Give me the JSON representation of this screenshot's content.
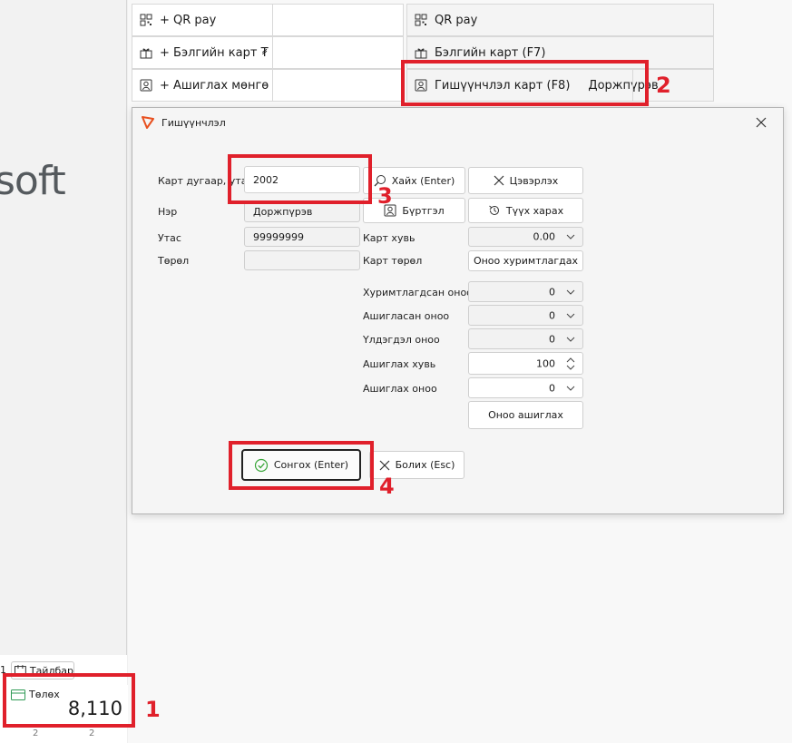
{
  "background": {
    "logo_text": "soft",
    "left_grid": [
      {
        "icon": "qr-icon",
        "label": "+ QR pay"
      },
      {
        "icon": "gift-card-icon",
        "label": "+ Бэлгийн карт ₮"
      },
      {
        "icon": "member-card-icon",
        "label": "+ Ашиглах мөнгө"
      }
    ],
    "right_grid": [
      {
        "icon": "qr-icon",
        "label": "QR pay",
        "value": ""
      },
      {
        "icon": "gift-card-icon",
        "label": "Бэлгийн карт (F7)",
        "value": ""
      },
      {
        "icon": "member-card-icon",
        "label": "Гишүүнчлэл карт (F8)",
        "value": "Доржпүрэв"
      }
    ],
    "note_prefix": "1",
    "note_button": "Тайлбар",
    "payment_label": "Төлөх",
    "payment_amount": "8,110",
    "footer_left": "2",
    "footer_right": "2"
  },
  "dialog": {
    "title": "Гишүүнчлэл",
    "labels": {
      "card_number": "Карт дугаар, утас",
      "name": "Нэр",
      "phone": "Утас",
      "type": "Төрөл",
      "card_rate": "Карт хувь",
      "card_type": "Карт төрөл",
      "accumulated": "Хуримтлагдсан оноо",
      "used": "Ашигласан оноо",
      "remaining": "Үлдэгдэл оноо",
      "use_rate": "Ашиглах хувь",
      "use_points": "Ашиглах оноо"
    },
    "values": {
      "card_number": "2002",
      "name": "Доржпүрэв",
      "phone": "99999999",
      "type": "",
      "card_rate": "0.00",
      "card_type": "Оноо хуримтлагдах",
      "accumulated": "0",
      "used": "0",
      "remaining": "0",
      "use_rate": "100",
      "use_points": "0"
    },
    "buttons": {
      "search": "Хайх (Enter)",
      "clear": "Цэвэрлэх",
      "register": "Бүртгэл",
      "history": "Түүх харах",
      "use_points": "Оноо ашиглах",
      "select": "Сонгох (Enter)",
      "cancel": "Болих (Esc)"
    }
  },
  "annotations": [
    "1",
    "2",
    "3",
    "4"
  ],
  "colors": {
    "annotation": "#e0202b",
    "app_accent": "#e8501f",
    "ok_check": "#3aa63a",
    "pay_icon": "#2f9a55"
  }
}
